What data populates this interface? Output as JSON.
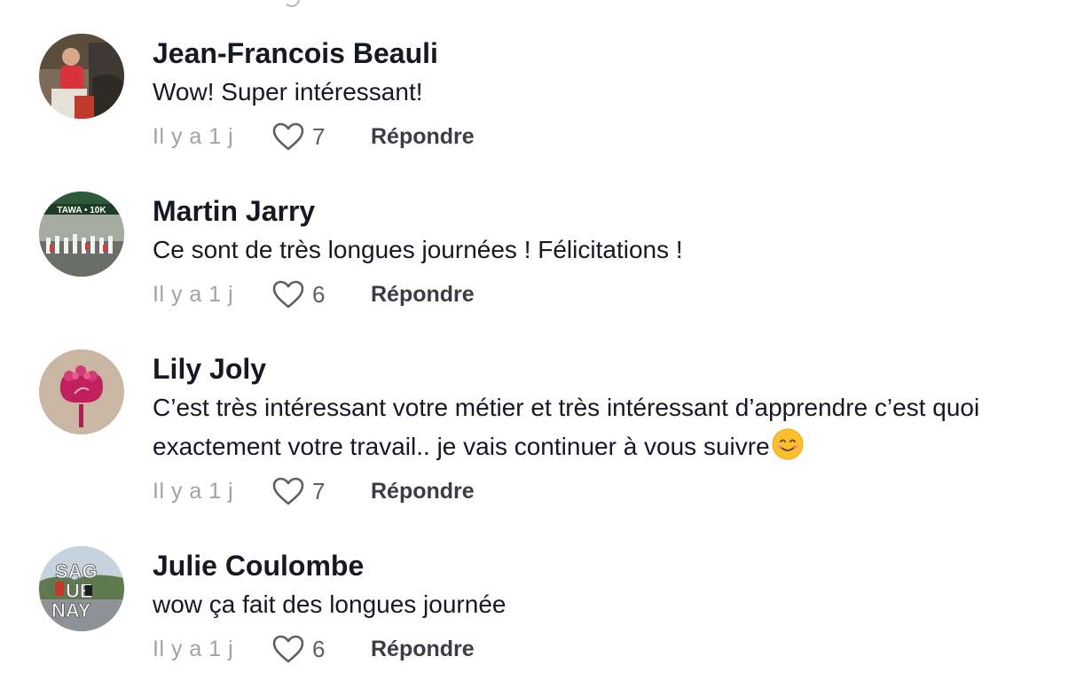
{
  "comments": [
    {
      "username": "Jean-Francois Beauli",
      "text": "Wow! Super intéressant!",
      "time": "Il y a 1 j",
      "likes": "7",
      "reply_label": "Répondre"
    },
    {
      "username": "Martin Jarry",
      "text": "Ce sont de très longues journées ! Félicitations !",
      "time": "Il y a 1 j",
      "likes": "6",
      "reply_label": "Répondre",
      "avatar_sign": "TAWA • 10K"
    },
    {
      "username": "Lily Joly",
      "text": "C’est très intéressant votre métier et très intéressant d’apprendre c’est quoi exactement votre travail.. je vais continuer à vous suivre",
      "emoji": "smiling-face-emoji",
      "time": "Il y a 1 j",
      "likes": "7",
      "reply_label": "Répondre"
    },
    {
      "username": "Julie Coulombe",
      "text": "wow ça fait des longues journée",
      "time": "Il y a 1 j",
      "likes": "6",
      "reply_label": "Répondre",
      "avatar_sign": [
        "SAG",
        "UE",
        "NAY"
      ]
    }
  ],
  "colors": {
    "username": "#161823",
    "time": "#a1a2a7",
    "reply": "#3b3c45",
    "like_icon": "#5d5e66"
  }
}
